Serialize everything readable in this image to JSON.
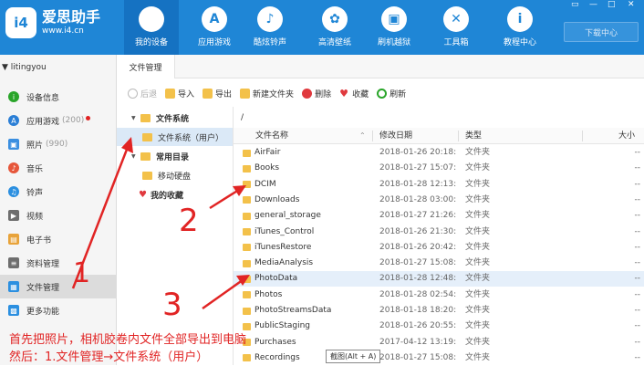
{
  "app": {
    "logo_badge": "i4",
    "logo_name": "爱思助手",
    "logo_url": "www.i4.cn",
    "download_label": "下载中心",
    "window_controls": [
      "▭",
      "—",
      "□",
      "✕"
    ]
  },
  "nav": [
    {
      "label": "我的设备",
      "icon": ""
    },
    {
      "label": "应用游戏",
      "icon": "A"
    },
    {
      "label": "酷炫铃声",
      "icon": "♪"
    },
    {
      "label": "高清壁纸",
      "icon": "✿"
    },
    {
      "label": "刷机越狱",
      "icon": "▣"
    },
    {
      "label": "工具箱",
      "icon": "✕"
    },
    {
      "label": "教程中心",
      "icon": "i"
    }
  ],
  "sidebar": {
    "user": "▼ litingyou",
    "items": [
      {
        "label": "设备信息",
        "count": "",
        "color": "#2aa52a"
      },
      {
        "label": "应用游戏",
        "count": "(200)",
        "color": "#2b7fd6"
      },
      {
        "label": "照片",
        "count": "(990)",
        "color": "#3a8ee0"
      },
      {
        "label": "音乐",
        "count": "",
        "color": "#e6563a"
      },
      {
        "label": "铃声",
        "count": "",
        "color": "#2b8fe0"
      },
      {
        "label": "视频",
        "count": "",
        "color": "#6e6e6e"
      },
      {
        "label": "电子书",
        "count": "",
        "color": "#e8a33a"
      },
      {
        "label": "资料管理",
        "count": "",
        "color": "#6e6e6e"
      },
      {
        "label": "文件管理",
        "count": "",
        "color": "#2b8fe0"
      },
      {
        "label": "更多功能",
        "count": "",
        "color": "#2b8fe0"
      }
    ]
  },
  "tabs": [
    "文件管理"
  ],
  "toolbar": [
    "后退",
    "导入",
    "导出",
    "新建文件夹",
    "删除",
    "收藏",
    "刷新"
  ],
  "tree": {
    "filesystem": "文件系统",
    "filesystem_user": "文件系统（用户）",
    "common": "常用目录",
    "mobile_disk": "移动硬盘",
    "favorites": "我的收藏"
  },
  "path": "/",
  "columns": {
    "name": "文件名称",
    "date": "修改日期",
    "type": "类型",
    "size": "大小"
  },
  "files": [
    {
      "name": "AirFair",
      "date": "2018-01-26 20:18:...",
      "type": "文件夹",
      "size": "--"
    },
    {
      "name": "Books",
      "date": "2018-01-27 15:07:...",
      "type": "文件夹",
      "size": "--"
    },
    {
      "name": "DCIM",
      "date": "2018-01-28 12:13:...",
      "type": "文件夹",
      "size": "--"
    },
    {
      "name": "Downloads",
      "date": "2018-01-28 03:00:...",
      "type": "文件夹",
      "size": "--"
    },
    {
      "name": "general_storage",
      "date": "2018-01-27 21:26:...",
      "type": "文件夹",
      "size": "--"
    },
    {
      "name": "iTunes_Control",
      "date": "2018-01-26 21:30:...",
      "type": "文件夹",
      "size": "--"
    },
    {
      "name": "iTunesRestore",
      "date": "2018-01-26 20:42:...",
      "type": "文件夹",
      "size": "--"
    },
    {
      "name": "MediaAnalysis",
      "date": "2018-01-27 15:08:...",
      "type": "文件夹",
      "size": "--"
    },
    {
      "name": "PhotoData",
      "date": "2018-01-28 12:48:...",
      "type": "文件夹",
      "size": "--"
    },
    {
      "name": "Photos",
      "date": "2018-01-28 02:54:...",
      "type": "文件夹",
      "size": "--"
    },
    {
      "name": "PhotoStreamsData",
      "date": "2018-01-18 18:20:...",
      "type": "文件夹",
      "size": "--"
    },
    {
      "name": "PublicStaging",
      "date": "2018-01-26 20:55:...",
      "type": "文件夹",
      "size": "--"
    },
    {
      "name": "Purchases",
      "date": "2017-04-12 13:19:...",
      "type": "文件夹",
      "size": "--"
    },
    {
      "name": "Recordings",
      "date": "2018-01-27 15:08:...",
      "type": "文件夹",
      "size": "--"
    }
  ],
  "tooltip": "截图(Alt + A)",
  "annotation": {
    "line1": "首先把照片，相机胶卷内文件全部导出到电脑",
    "line2": "然后：1.文件管理→文件系统（用户）",
    "num1": "1",
    "num2": "2",
    "num3": "3"
  }
}
